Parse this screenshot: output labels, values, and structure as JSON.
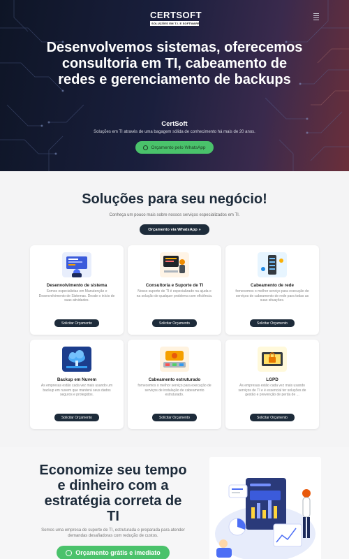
{
  "header": {
    "logo_word": "CERTSOFT",
    "logo_tagline": "SOLUÇÕES EM T.I. E SOFTWARE",
    "menu_icon": "hamburger-icon"
  },
  "hero": {
    "title": "Desenvolvemos sistemas, oferecemos consultoria em TI, cabeamento de redes e gerenciamento de backups",
    "brand": "CertSoft",
    "subtitle": "Soluções em TI através de uma bagagem sólida de conhecimento há mais de 20 anos.",
    "cta_label": "Orçamento pelo WhatsApp",
    "cta_icon": "whatsapp-icon"
  },
  "solutions": {
    "title": "Soluções para seu negócio!",
    "subtitle": "Conheça um pouco mais sobre nossos serviços especializados em TI.",
    "cta_label": "Orçamento via WhatsApp »",
    "cards": [
      {
        "title": "Desenvolvimento de sistema",
        "desc": "Somos especialistas em Manutenção e Desenvolvimento de Sistemas. Desde o início de suas atividades.",
        "button": "Solicitar Orçamento",
        "icon": "software-development-icon"
      },
      {
        "title": "Consultoria e Suporte de TI",
        "desc": "Nosso suporte de TI é especializado na ajuda e na solução de qualquer problema com eficiência.",
        "button": "Solicitar Orçamento",
        "icon": "it-support-icon"
      },
      {
        "title": "Cabeamento de rede",
        "desc": "fornecemos o melhor serviço para execução de serviços de cabeamento de rede para todas as suas situações.",
        "button": "Solicitar Orçamento",
        "icon": "network-cabling-icon"
      },
      {
        "title": "Backup em Nuvem",
        "desc": "As empresas estão cada vez mais usando um backup em nuvem que manterá seus dados seguros e protegidos.",
        "button": "Solicitar Orçamento",
        "icon": "cloud-backup-icon"
      },
      {
        "title": "Cabeamento estruturado",
        "desc": "fornecemos o melhor serviço para execução de serviços de instalação de cabeamento estruturado.",
        "button": "Solicitar Orçamento",
        "icon": "structured-cabling-icon"
      },
      {
        "title": "LGPD",
        "desc": "As empresas estão cada vez mais usando serviços de TI e é essencial ter soluções de gestão e prevenção de perda de ...",
        "button": "Solicitar Orçamento",
        "icon": "lgpd-icon"
      }
    ]
  },
  "economize": {
    "title": "Economize seu tempo e dinheiro com a estratégia correta de TI",
    "subtitle": "Somos uma empresa de suporte de TI, estruturada e preparada para atender demandas desafiadoras com redução de custos.",
    "cta_label": "Orçamento grátis e imediato",
    "cta_icon": "whatsapp-icon",
    "illustration": "dashboard-analytics-illustration"
  },
  "colors": {
    "navy": "#1d2b3a",
    "whatsapp_green": "#4ac26b",
    "hero_bg": "#141a30"
  }
}
